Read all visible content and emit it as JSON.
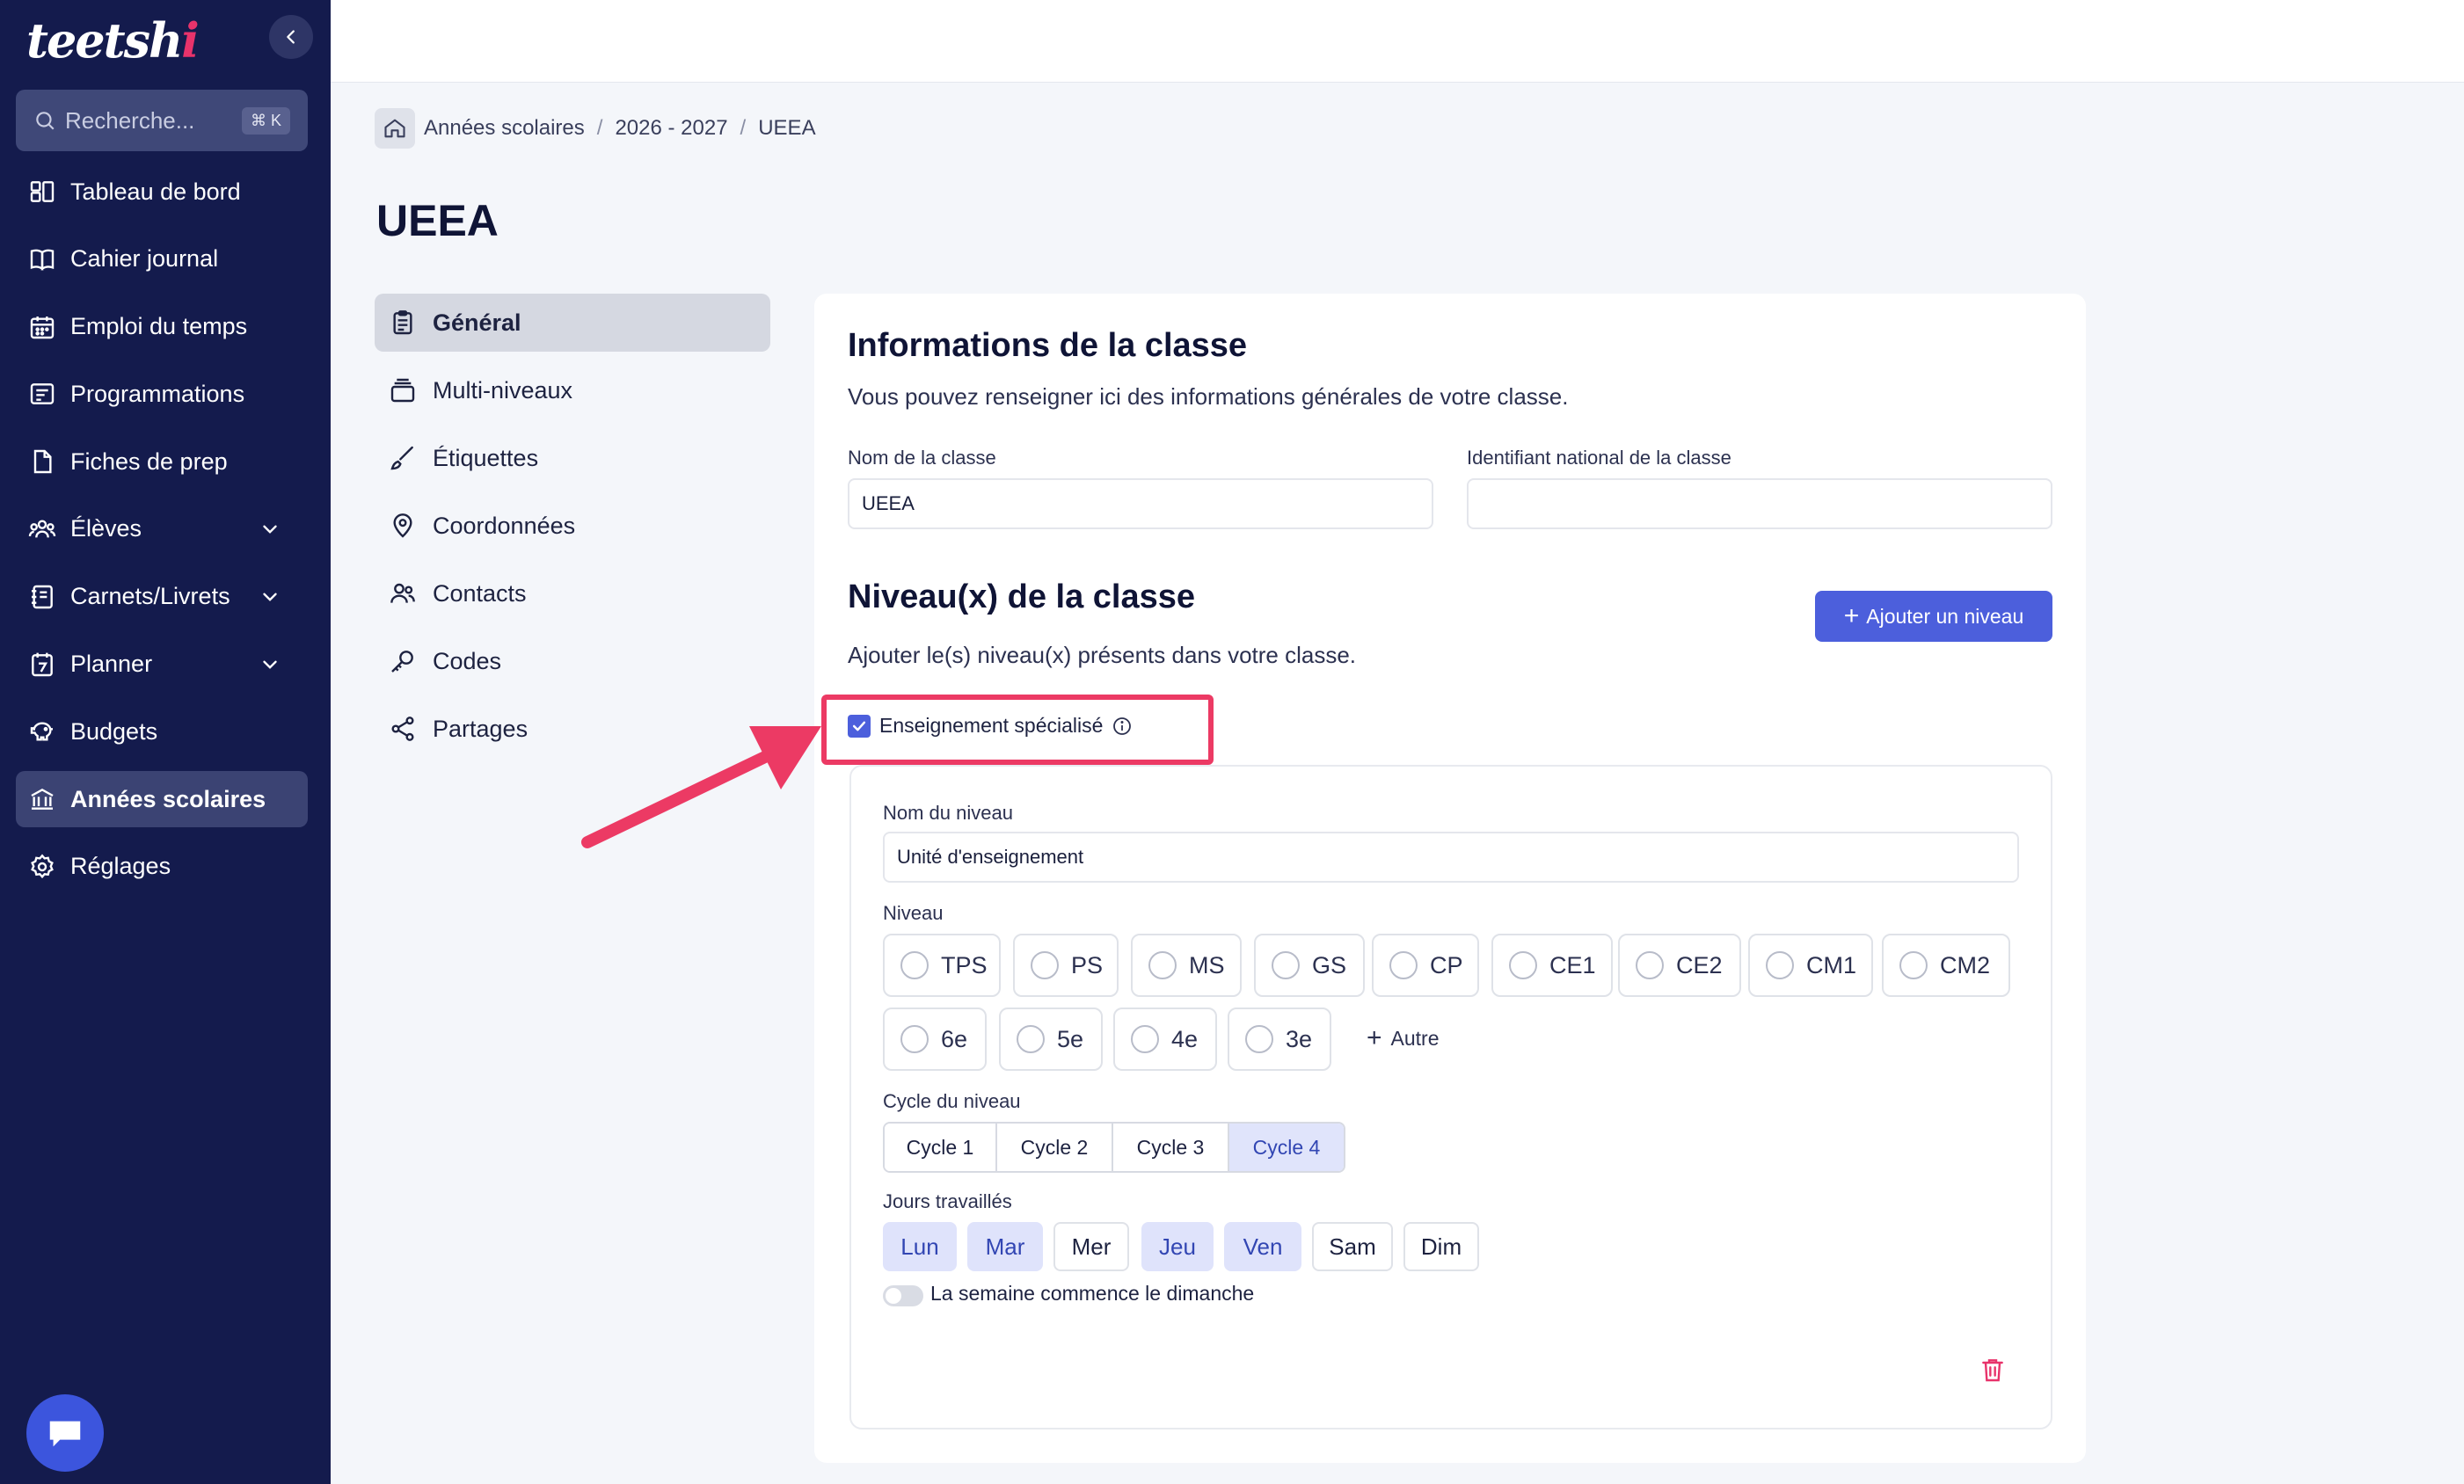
{
  "app": {
    "logo_main": "teetsh",
    "logo_accent": "i"
  },
  "sidebar": {
    "search": {
      "placeholder": "Recherche...",
      "shortcut": "⌘ K"
    },
    "items": [
      {
        "label": "Tableau de bord",
        "icon": "dashboard-icon"
      },
      {
        "label": "Cahier journal",
        "icon": "book-icon"
      },
      {
        "label": "Emploi du temps",
        "icon": "calendar-icon"
      },
      {
        "label": "Programmations",
        "icon": "list-board-icon"
      },
      {
        "label": "Fiches de prep",
        "icon": "document-icon"
      },
      {
        "label": "Élèves",
        "icon": "users-icon",
        "expandable": true
      },
      {
        "label": "Carnets/Livrets",
        "icon": "notebook-icon",
        "expandable": true
      },
      {
        "label": "Planner",
        "icon": "planner-icon",
        "expandable": true
      },
      {
        "label": "Budgets",
        "icon": "piggy-bank-icon"
      },
      {
        "label": "Années scolaires",
        "icon": "school-icon",
        "active": true
      },
      {
        "label": "Réglages",
        "icon": "gear-icon"
      }
    ]
  },
  "breadcrumb": {
    "items": [
      "Années scolaires",
      "2026 - 2027",
      "UEEA"
    ],
    "separator": "/"
  },
  "page": {
    "title": "UEEA"
  },
  "subnav": {
    "items": [
      {
        "label": "Général",
        "icon": "clipboard-icon",
        "active": true
      },
      {
        "label": "Multi-niveaux",
        "icon": "layers-icon"
      },
      {
        "label": "Étiquettes",
        "icon": "brush-icon"
      },
      {
        "label": "Coordonnées",
        "icon": "location-pin-icon"
      },
      {
        "label": "Contacts",
        "icon": "contacts-icon"
      },
      {
        "label": "Codes",
        "icon": "key-icon"
      },
      {
        "label": "Partages",
        "icon": "share-icon"
      }
    ]
  },
  "class_info": {
    "title": "Informations de la classe",
    "description": "Vous pouvez renseigner ici des informations générales de votre classe.",
    "name_label": "Nom de la classe",
    "name_value": "UEEA",
    "national_id_label": "Identifiant national de la classe",
    "national_id_value": ""
  },
  "levels": {
    "title": "Niveau(x) de la classe",
    "description": "Ajouter le(s) niveau(x) présents dans votre classe.",
    "add_button": "Ajouter un niveau",
    "specialised_label": "Enseignement spécialisé",
    "specialised_checked": true,
    "level_name_label": "Nom du niveau",
    "level_name_value": "Unité d'enseignement",
    "niveau_label": "Niveau",
    "niveaux_row1": [
      "TPS",
      "PS",
      "MS",
      "GS",
      "CP",
      "CE1",
      "CE2",
      "CM1",
      "CM2"
    ],
    "niveaux_row2": [
      "6e",
      "5e",
      "4e",
      "3e"
    ],
    "other_label": "Autre",
    "cycle_label": "Cycle du niveau",
    "cycles": [
      {
        "label": "Cycle 1",
        "selected": false
      },
      {
        "label": "Cycle 2",
        "selected": false
      },
      {
        "label": "Cycle 3",
        "selected": false
      },
      {
        "label": "Cycle 4",
        "selected": true
      }
    ],
    "days_label": "Jours travaillés",
    "days": [
      {
        "label": "Lun",
        "selected": true
      },
      {
        "label": "Mar",
        "selected": true
      },
      {
        "label": "Mer",
        "selected": false
      },
      {
        "label": "Jeu",
        "selected": true
      },
      {
        "label": "Ven",
        "selected": true
      },
      {
        "label": "Sam",
        "selected": false
      },
      {
        "label": "Dim",
        "selected": false
      }
    ],
    "week_start_label": "La semaine commence le dimanche",
    "week_start_on": false
  },
  "colors": {
    "sidebar": "#141b4d",
    "accent": "#4c5fdc",
    "highlight": "#ec3a64"
  }
}
